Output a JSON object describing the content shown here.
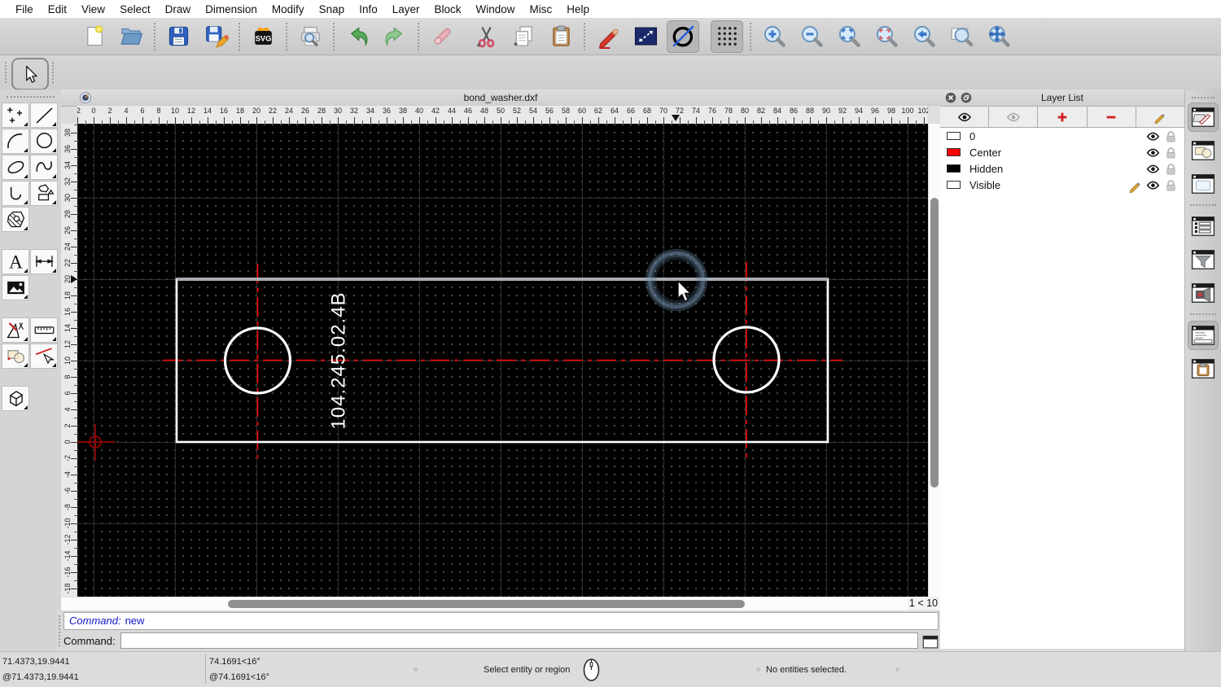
{
  "menu": {
    "items": [
      "File",
      "Edit",
      "View",
      "Select",
      "Draw",
      "Dimension",
      "Modify",
      "Snap",
      "Info",
      "Layer",
      "Block",
      "Window",
      "Misc",
      "Help"
    ]
  },
  "toolbar": {
    "groups": [
      {
        "sep": "none",
        "items": [
          {
            "name": "new-file",
            "label": "New"
          },
          {
            "name": "open-file",
            "label": "Open"
          }
        ]
      },
      {
        "sep": "dots",
        "items": [
          {
            "name": "save",
            "label": "Save"
          },
          {
            "name": "save-as",
            "label": "Save As"
          }
        ]
      },
      {
        "sep": "dots",
        "items": [
          {
            "name": "export-svg",
            "label": "Export as SVG"
          }
        ]
      },
      {
        "sep": "dots",
        "items": [
          {
            "name": "print-preview",
            "label": "Print Preview"
          }
        ]
      },
      {
        "sep": "dots",
        "items": [
          {
            "name": "undo",
            "label": "Undo"
          },
          {
            "name": "redo",
            "label": "Redo"
          }
        ]
      },
      {
        "sep": "dots",
        "items": [
          {
            "name": "erase",
            "label": "Delete"
          }
        ]
      },
      {
        "sep": "gap",
        "items": [
          {
            "name": "cut",
            "label": "Cut"
          },
          {
            "name": "copy",
            "label": "Copy"
          },
          {
            "name": "paste",
            "label": "Paste"
          }
        ]
      },
      {
        "sep": "dots",
        "items": [
          {
            "name": "draw-pencil",
            "label": "Pen"
          },
          {
            "name": "select-window",
            "label": "Select Window"
          },
          {
            "name": "draw-circle",
            "label": "Circle",
            "pressed": true
          }
        ]
      },
      {
        "sep": "gap",
        "items": [
          {
            "name": "grid-dots",
            "label": "Grid",
            "pressed": true
          }
        ]
      },
      {
        "sep": "dots",
        "items": [
          {
            "name": "zoom-in",
            "label": "Zoom In"
          },
          {
            "name": "zoom-out",
            "label": "Zoom Out"
          },
          {
            "name": "zoom-auto",
            "label": "Auto Zoom"
          },
          {
            "name": "zoom-selected",
            "label": "Zoom Selected"
          },
          {
            "name": "zoom-previous",
            "label": "Previous View"
          },
          {
            "name": "zoom-window",
            "label": "Window Zoom"
          },
          {
            "name": "zoom-pan",
            "label": "Zoom Panning"
          }
        ]
      }
    ]
  },
  "palette": {
    "groups": [
      {
        "tools": [
          {
            "name": "points"
          },
          {
            "name": "line"
          },
          {
            "name": "arc"
          },
          {
            "name": "circle"
          },
          {
            "name": "ellipse"
          },
          {
            "name": "spline"
          },
          {
            "name": "polyline"
          },
          {
            "name": "polygon"
          },
          {
            "name": "hatch"
          }
        ]
      },
      {
        "tools": [
          {
            "name": "text"
          },
          {
            "name": "dimension"
          },
          {
            "name": "image"
          }
        ]
      },
      {
        "tools": [
          {
            "name": "modify"
          },
          {
            "name": "measure"
          },
          {
            "name": "block"
          },
          {
            "name": "select-entity"
          }
        ]
      },
      {
        "tools": [
          {
            "name": "cube3d"
          }
        ]
      }
    ]
  },
  "document": {
    "title": "bond_washer.dxf",
    "label_text": "104.245.02.4B",
    "zoom_indicator": "1 < 10"
  },
  "rulers": {
    "horizontal": [
      "-2",
      "0",
      "2",
      "4",
      "6",
      "8",
      "10",
      "12",
      "14",
      "16",
      "18",
      "20",
      "22",
      "24",
      "26",
      "28",
      "30",
      "32",
      "34",
      "36",
      "38",
      "40",
      "42",
      "44",
      "46",
      "48",
      "50",
      "52",
      "54",
      "56",
      "58",
      "60",
      "62",
      "64",
      "66",
      "68",
      "70",
      "72",
      "74",
      "76",
      "78",
      "80",
      "82",
      "84",
      "86",
      "88",
      "90",
      "92",
      "94",
      "96",
      "98",
      "100",
      "102"
    ],
    "vertical": [
      "38",
      "36",
      "34",
      "32",
      "30",
      "28",
      "26",
      "24",
      "22",
      "20",
      "18",
      "16",
      "14",
      "12",
      "10",
      "8",
      "6",
      "4",
      "2",
      "0",
      "-2",
      "-4",
      "-6",
      "-8",
      "-10",
      "-12",
      "-14",
      "-16",
      "-18"
    ]
  },
  "layer_list": {
    "title": "Layer List",
    "layers": [
      {
        "name": "0",
        "color": "#ffffff",
        "editing": false
      },
      {
        "name": "Center",
        "color": "#ff0000",
        "editing": false
      },
      {
        "name": "Hidden",
        "color": "#000000",
        "editing": false
      },
      {
        "name": "Visible",
        "color": "#ffffff",
        "editing": true
      }
    ]
  },
  "right_dock": {
    "groups": [
      {
        "items": [
          {
            "name": "layer-list-window",
            "pressed": true
          },
          {
            "name": "block-list-window"
          },
          {
            "name": "library-browser-window"
          }
        ]
      },
      {
        "items": [
          {
            "name": "entity-list-window"
          },
          {
            "name": "selection-filter-window"
          },
          {
            "name": "device-window"
          }
        ]
      },
      {
        "items": [
          {
            "name": "command-line-window",
            "pressed": true
          },
          {
            "name": "clipboard-window"
          }
        ]
      }
    ]
  },
  "command": {
    "history_label": "Command:",
    "history_value": "new",
    "prompt_label": "Command:",
    "input_value": ""
  },
  "status": {
    "abs": "71.4373,19.9441",
    "rel": "@71.4373,19.9441",
    "polar": "74.1691<16°",
    "polar_rel": "@74.1691<16°",
    "hint": "Select entity or region",
    "selection": "No entities selected."
  },
  "colors": {
    "canvas": "#000000",
    "center_line": "#ff0000",
    "entity": "#ffffff",
    "highlight_edge": "#a7adb2",
    "origin_marker": "#a00000",
    "layer_red": "#ff0000"
  }
}
